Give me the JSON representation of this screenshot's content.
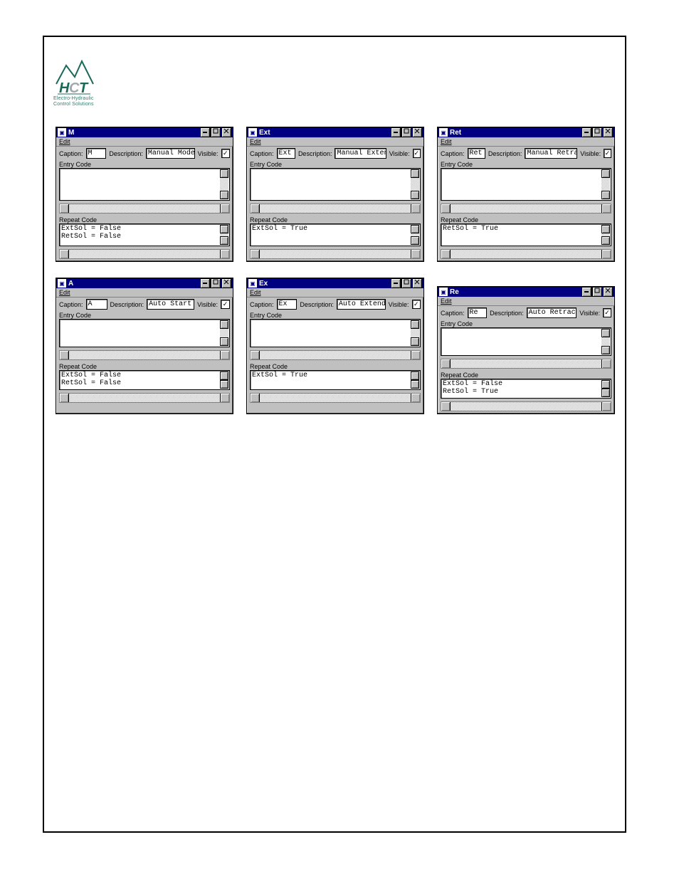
{
  "logo": {
    "line1": "Electro-Hydraulic",
    "line2": "Control Solutions"
  },
  "labels": {
    "caption": "Caption:",
    "description": "Description:",
    "visible": "Visible:",
    "entry_code": "Entry Code",
    "repeat_code": "Repeat Code",
    "edit": "Edit",
    "check": "✓"
  },
  "dialogs": [
    {
      "id": "m",
      "title": "M",
      "caption": "M",
      "description": "Manual Mode",
      "visible": true,
      "entry_code": "",
      "repeat_code": "ExtSol = False\nRetSol = False"
    },
    {
      "id": "ext",
      "title": "Ext",
      "caption": "Ext",
      "description": "Manual Extend",
      "visible": true,
      "entry_code": "",
      "repeat_code": "ExtSol = True"
    },
    {
      "id": "ret",
      "title": "Ret",
      "caption": "Ret",
      "description": "Manual Retract",
      "visible": true,
      "entry_code": "",
      "repeat_code": "RetSol = True"
    },
    {
      "id": "a",
      "title": "A",
      "caption": "A",
      "description": "Auto Start",
      "visible": true,
      "entry_code": "",
      "repeat_code": "ExtSol = False\nRetSol = False"
    },
    {
      "id": "ex",
      "title": "Ex",
      "caption": "Ex",
      "description": "Auto Extend",
      "visible": true,
      "entry_code": "",
      "repeat_code": "ExtSol = True"
    },
    {
      "id": "re",
      "title": "Re",
      "caption": "Re",
      "description": "Auto Retract",
      "visible": true,
      "entry_code": "",
      "repeat_code": "ExtSol = False\nRetSol = True"
    }
  ]
}
